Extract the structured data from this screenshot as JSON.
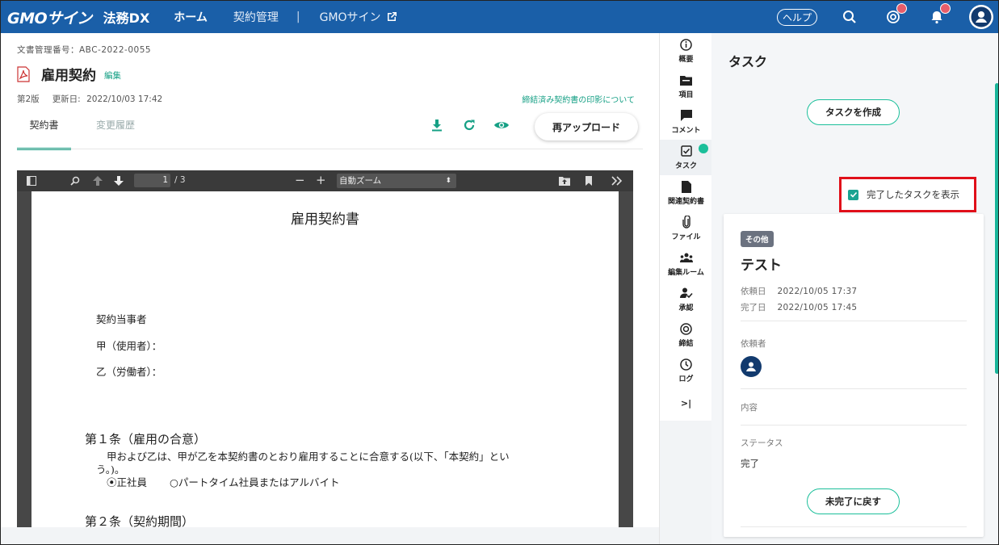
{
  "topbar": {
    "logo": "GMOサイン",
    "product": "法務DX",
    "nav_home": "ホーム",
    "nav_contracts": "契約管理",
    "nav_separator": "|",
    "nav_gmo": "GMOサイン",
    "help": "ヘルプ",
    "icons": [
      "search-icon",
      "mention-icon",
      "bell-icon",
      "user-avatar-icon"
    ],
    "colors": {
      "bar": "#1a5fa8",
      "badge": "#e75d6a"
    }
  },
  "document": {
    "number_label": "文書管理番号：",
    "number": "ABC-2022-0055",
    "title": "雇用契約",
    "edit": "編集",
    "version": "第2版",
    "updated_label": "更新日:",
    "updated": "2022/10/03 17:42",
    "seal_link": "締結済み契約書の印影について",
    "tabs": [
      "契約書",
      "変更履歴"
    ],
    "active_tab": "契約書",
    "reupload": "再アップロード",
    "accent": "#16a085"
  },
  "viewer": {
    "page_current": "1",
    "page_total": "/ 3",
    "zoom_minus": "−",
    "zoom_plus": "+",
    "zoom": "自動ズーム",
    "zoom_caret": "⬍",
    "page": {
      "title": "雇用契約書",
      "parties": "契約当事者",
      "party_a": "甲（使用者）：",
      "party_b": "乙（労働者）：",
      "article1": "第１条（雇用の合意）",
      "article1_text1": "甲および乙は、甲が乙を本契約書のとおり雇用することに合意する(以下、「本契約」とい",
      "article1_text2": "う。)。",
      "option_regular": "⦿正社員",
      "option_part": "○パートタイム社員またはアルバイト",
      "article2_partial": "第２条（契約期間）"
    }
  },
  "rail": {
    "items": [
      {
        "label": "概要",
        "icon": "info-icon"
      },
      {
        "label": "項目",
        "icon": "folder-icon"
      },
      {
        "label": "コメント",
        "icon": "comment-icon"
      },
      {
        "label": "タスク",
        "icon": "task-check-icon"
      },
      {
        "label": "関連契約書",
        "icon": "document-icon"
      },
      {
        "label": "ファイル",
        "icon": "paperclip-icon"
      },
      {
        "label": "編集ルーム",
        "icon": "group-icon"
      },
      {
        "label": "承認",
        "icon": "approve-user-icon"
      },
      {
        "label": "締結",
        "icon": "target-icon"
      },
      {
        "label": "ログ",
        "icon": "clock-icon"
      }
    ],
    "collapse": ">|",
    "active": "タスク"
  },
  "tasks": {
    "heading": "タスク",
    "create_button": "タスクを作成",
    "show_completed": "完了したタスクを表示",
    "show_completed_checked": true,
    "card": {
      "tag": "その他",
      "title": "テスト",
      "requested_label": "依頼日",
      "requested": "2022/10/05 17:37",
      "completed_label": "完了日",
      "completed": "2022/10/05 17:45",
      "requester_label": "依頼者",
      "content_label": "内容",
      "status_label": "ステータス",
      "status": "完了",
      "revert_button": "未完了に戻す"
    },
    "accent": "#1bbf9a",
    "highlight": "#e0101a"
  }
}
